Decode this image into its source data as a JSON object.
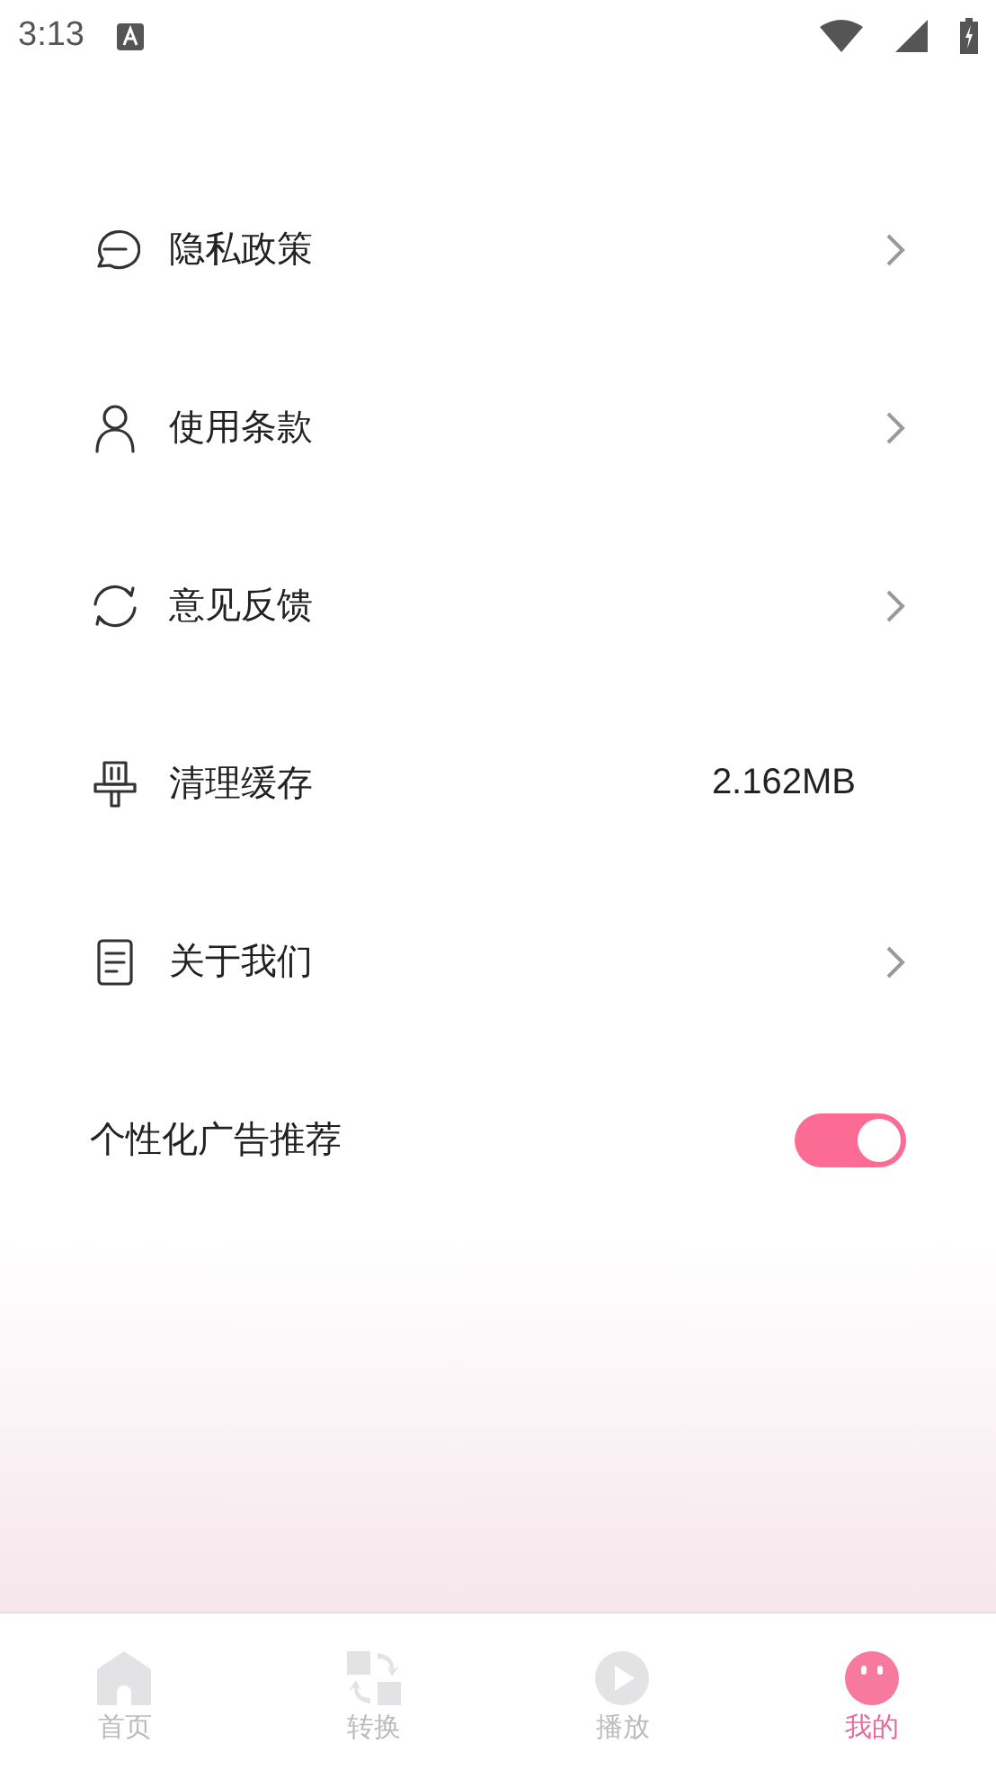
{
  "status_bar": {
    "time": "3:13"
  },
  "settings": [
    {
      "kind": "link",
      "label": "隐私政策"
    },
    {
      "kind": "link",
      "label": "使用条款"
    },
    {
      "kind": "link",
      "label": "意见反馈"
    },
    {
      "kind": "value",
      "label": "清理缓存",
      "value": "2.162MB"
    },
    {
      "kind": "link",
      "label": "关于我们"
    },
    {
      "kind": "toggle",
      "label": "个性化广告推荐",
      "on": true
    }
  ],
  "tab_bar": [
    {
      "label": "首页",
      "selected": false
    },
    {
      "label": "转换",
      "selected": false
    },
    {
      "label": "播放",
      "selected": false
    },
    {
      "label": "我的",
      "selected": true
    }
  ]
}
